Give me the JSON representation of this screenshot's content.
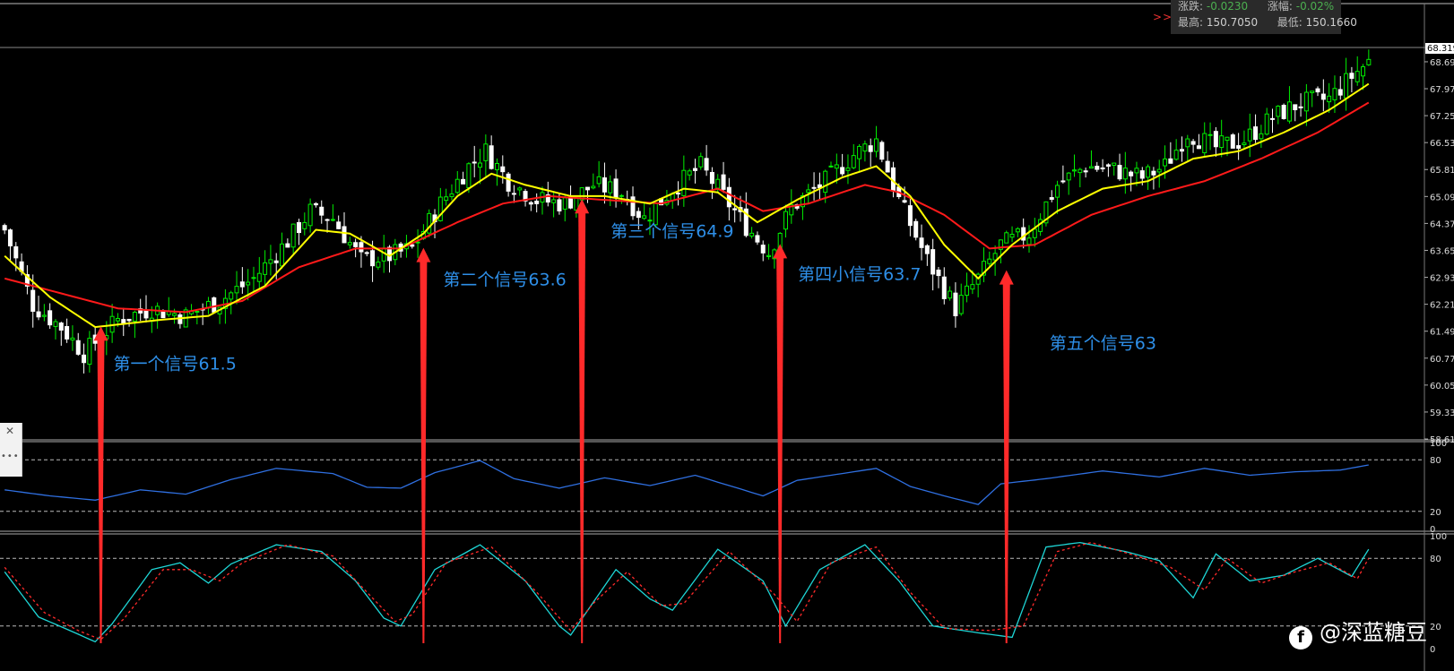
{
  "info_panel": {
    "change_label": "涨跌:",
    "change_value": "-0.0230",
    "pct_label": "涨幅:",
    "pct_value": "-0.02%",
    "high_label": "最高:",
    "high_value": "150.7050",
    "low_label": "最低:",
    "low_value": "150.1660",
    "arrows": ">>"
  },
  "watermark": {
    "text": "@深蓝糖豆"
  },
  "colors": {
    "background": "#000000",
    "bull_candle": "#00ee00",
    "bear_candle": "#ffffff",
    "fast_ma": "#ffff00",
    "slow_ma": "#ff1a1a",
    "rsi_line": "#2f6fe0",
    "stoch_k": "#1ed6d6",
    "stoch_d": "#ff2a2a",
    "annotation_text": "#2e8fe8",
    "signal_arrow": "#ff2a2a"
  },
  "chart_data": [
    {
      "type": "candlestick",
      "name": "price",
      "ylim": [
        58.61,
        69.0
      ],
      "current_price": "68.319",
      "y_ticks": [
        "68.690",
        "67.970",
        "67.250",
        "66.530",
        "65.810",
        "65.090",
        "64.370",
        "63.650",
        "62.930",
        "62.210",
        "61.490",
        "60.770",
        "60.050",
        "59.330",
        "58.610"
      ],
      "close_path": [
        {
          "i": 0,
          "v": 64.2
        },
        {
          "i": 5,
          "v": 62.2
        },
        {
          "i": 10,
          "v": 61.6
        },
        {
          "i": 14,
          "v": 60.9
        },
        {
          "i": 20,
          "v": 61.8
        },
        {
          "i": 26,
          "v": 62.1
        },
        {
          "i": 32,
          "v": 61.9
        },
        {
          "i": 38,
          "v": 62.3
        },
        {
          "i": 44,
          "v": 62.9
        },
        {
          "i": 50,
          "v": 63.9
        },
        {
          "i": 54,
          "v": 64.7
        },
        {
          "i": 58,
          "v": 64.5
        },
        {
          "i": 63,
          "v": 63.4
        },
        {
          "i": 68,
          "v": 63.5
        },
        {
          "i": 72,
          "v": 63.7
        },
        {
          "i": 77,
          "v": 64.9
        },
        {
          "i": 82,
          "v": 65.9
        },
        {
          "i": 85,
          "v": 66.3
        },
        {
          "i": 89,
          "v": 65.5
        },
        {
          "i": 94,
          "v": 65.0
        },
        {
          "i": 99,
          "v": 64.9
        },
        {
          "i": 104,
          "v": 65.4
        },
        {
          "i": 109,
          "v": 65.2
        },
        {
          "i": 113,
          "v": 64.5
        },
        {
          "i": 118,
          "v": 65.3
        },
        {
          "i": 123,
          "v": 65.9
        },
        {
          "i": 127,
          "v": 65.1
        },
        {
          "i": 131,
          "v": 64.3
        },
        {
          "i": 135,
          "v": 63.6
        },
        {
          "i": 139,
          "v": 64.8
        },
        {
          "i": 145,
          "v": 65.5
        },
        {
          "i": 150,
          "v": 66.2
        },
        {
          "i": 154,
          "v": 66.6
        },
        {
          "i": 158,
          "v": 65.0
        },
        {
          "i": 163,
          "v": 63.4
        },
        {
          "i": 168,
          "v": 62.1
        },
        {
          "i": 172,
          "v": 62.9
        },
        {
          "i": 176,
          "v": 63.8
        },
        {
          "i": 181,
          "v": 64.1
        },
        {
          "i": 186,
          "v": 65.4
        },
        {
          "i": 191,
          "v": 65.9
        },
        {
          "i": 196,
          "v": 65.8
        },
        {
          "i": 201,
          "v": 65.6
        },
        {
          "i": 205,
          "v": 65.9
        },
        {
          "i": 209,
          "v": 66.8
        },
        {
          "i": 214,
          "v": 66.4
        },
        {
          "i": 219,
          "v": 66.6
        },
        {
          "i": 224,
          "v": 67.2
        },
        {
          "i": 229,
          "v": 67.6
        },
        {
          "i": 234,
          "v": 67.7
        },
        {
          "i": 238,
          "v": 68.3
        },
        {
          "i": 241,
          "v": 68.7
        }
      ],
      "bar_count": 242,
      "fast_ma_path": [
        {
          "i": 0,
          "v": 63.5
        },
        {
          "i": 8,
          "v": 62.4
        },
        {
          "i": 16,
          "v": 61.6
        },
        {
          "i": 28,
          "v": 61.8
        },
        {
          "i": 36,
          "v": 61.9
        },
        {
          "i": 46,
          "v": 62.7
        },
        {
          "i": 55,
          "v": 64.2
        },
        {
          "i": 61,
          "v": 64.1
        },
        {
          "i": 68,
          "v": 63.5
        },
        {
          "i": 74,
          "v": 64.1
        },
        {
          "i": 80,
          "v": 65.1
        },
        {
          "i": 86,
          "v": 65.7
        },
        {
          "i": 92,
          "v": 65.4
        },
        {
          "i": 100,
          "v": 65.1
        },
        {
          "i": 106,
          "v": 65.1
        },
        {
          "i": 114,
          "v": 64.9
        },
        {
          "i": 120,
          "v": 65.3
        },
        {
          "i": 126,
          "v": 65.2
        },
        {
          "i": 133,
          "v": 64.4
        },
        {
          "i": 140,
          "v": 65.0
        },
        {
          "i": 148,
          "v": 65.6
        },
        {
          "i": 154,
          "v": 65.9
        },
        {
          "i": 160,
          "v": 65.1
        },
        {
          "i": 166,
          "v": 63.8
        },
        {
          "i": 172,
          "v": 62.9
        },
        {
          "i": 178,
          "v": 63.8
        },
        {
          "i": 186,
          "v": 64.7
        },
        {
          "i": 194,
          "v": 65.3
        },
        {
          "i": 202,
          "v": 65.5
        },
        {
          "i": 210,
          "v": 66.1
        },
        {
          "i": 218,
          "v": 66.3
        },
        {
          "i": 226,
          "v": 66.8
        },
        {
          "i": 234,
          "v": 67.4
        },
        {
          "i": 241,
          "v": 68.1
        }
      ],
      "slow_ma_path": [
        {
          "i": 0,
          "v": 62.9
        },
        {
          "i": 10,
          "v": 62.5
        },
        {
          "i": 20,
          "v": 62.1
        },
        {
          "i": 32,
          "v": 62.0
        },
        {
          "i": 42,
          "v": 62.3
        },
        {
          "i": 52,
          "v": 63.2
        },
        {
          "i": 62,
          "v": 63.7
        },
        {
          "i": 70,
          "v": 63.7
        },
        {
          "i": 80,
          "v": 64.4
        },
        {
          "i": 88,
          "v": 64.9
        },
        {
          "i": 96,
          "v": 65.1
        },
        {
          "i": 106,
          "v": 65.0
        },
        {
          "i": 116,
          "v": 64.9
        },
        {
          "i": 126,
          "v": 65.3
        },
        {
          "i": 134,
          "v": 64.7
        },
        {
          "i": 142,
          "v": 64.9
        },
        {
          "i": 152,
          "v": 65.4
        },
        {
          "i": 158,
          "v": 65.2
        },
        {
          "i": 166,
          "v": 64.6
        },
        {
          "i": 174,
          "v": 63.7
        },
        {
          "i": 182,
          "v": 63.8
        },
        {
          "i": 192,
          "v": 64.6
        },
        {
          "i": 202,
          "v": 65.1
        },
        {
          "i": 212,
          "v": 65.5
        },
        {
          "i": 222,
          "v": 66.1
        },
        {
          "i": 232,
          "v": 66.8
        },
        {
          "i": 241,
          "v": 67.6
        }
      ]
    },
    {
      "type": "line",
      "name": "oscillator-1",
      "ylim": [
        0,
        100
      ],
      "y_ticks": [
        "100",
        "80",
        "20",
        "0"
      ],
      "levels": [
        80,
        20
      ],
      "series": [
        {
          "path": [
            {
              "i": 0,
              "v": 45
            },
            {
              "i": 8,
              "v": 38
            },
            {
              "i": 16,
              "v": 33
            },
            {
              "i": 24,
              "v": 45
            },
            {
              "i": 32,
              "v": 40
            },
            {
              "i": 40,
              "v": 57
            },
            {
              "i": 48,
              "v": 70
            },
            {
              "i": 58,
              "v": 64
            },
            {
              "i": 64,
              "v": 48
            },
            {
              "i": 70,
              "v": 47
            },
            {
              "i": 76,
              "v": 65
            },
            {
              "i": 84,
              "v": 79
            },
            {
              "i": 90,
              "v": 58
            },
            {
              "i": 98,
              "v": 47
            },
            {
              "i": 106,
              "v": 59
            },
            {
              "i": 114,
              "v": 50
            },
            {
              "i": 122,
              "v": 62
            },
            {
              "i": 128,
              "v": 50
            },
            {
              "i": 134,
              "v": 38
            },
            {
              "i": 140,
              "v": 56
            },
            {
              "i": 148,
              "v": 64
            },
            {
              "i": 154,
              "v": 70
            },
            {
              "i": 160,
              "v": 49
            },
            {
              "i": 166,
              "v": 38
            },
            {
              "i": 172,
              "v": 28
            },
            {
              "i": 176,
              "v": 52
            },
            {
              "i": 184,
              "v": 58
            },
            {
              "i": 194,
              "v": 67
            },
            {
              "i": 204,
              "v": 60
            },
            {
              "i": 212,
              "v": 70
            },
            {
              "i": 220,
              "v": 62
            },
            {
              "i": 228,
              "v": 66
            },
            {
              "i": 236,
              "v": 68
            },
            {
              "i": 241,
              "v": 74
            }
          ]
        }
      ]
    },
    {
      "type": "line",
      "name": "oscillator-2",
      "ylim": [
        0,
        100
      ],
      "y_ticks": [
        "100",
        "80",
        "20",
        "0"
      ],
      "levels": [
        80,
        20
      ],
      "series": [
        {
          "path": [
            {
              "i": 0,
              "v": 68
            },
            {
              "i": 6,
              "v": 28
            },
            {
              "i": 12,
              "v": 15
            },
            {
              "i": 16,
              "v": 6
            },
            {
              "i": 19,
              "v": 22
            },
            {
              "i": 26,
              "v": 70
            },
            {
              "i": 31,
              "v": 76
            },
            {
              "i": 36,
              "v": 58
            },
            {
              "i": 40,
              "v": 75
            },
            {
              "i": 48,
              "v": 92
            },
            {
              "i": 56,
              "v": 86
            },
            {
              "i": 62,
              "v": 60
            },
            {
              "i": 67,
              "v": 27
            },
            {
              "i": 70,
              "v": 20
            },
            {
              "i": 76,
              "v": 70
            },
            {
              "i": 84,
              "v": 92
            },
            {
              "i": 92,
              "v": 60
            },
            {
              "i": 98,
              "v": 20
            },
            {
              "i": 100,
              "v": 12
            },
            {
              "i": 108,
              "v": 70
            },
            {
              "i": 114,
              "v": 44
            },
            {
              "i": 118,
              "v": 34
            },
            {
              "i": 126,
              "v": 88
            },
            {
              "i": 134,
              "v": 60
            },
            {
              "i": 138,
              "v": 20
            },
            {
              "i": 144,
              "v": 70
            },
            {
              "i": 152,
              "v": 92
            },
            {
              "i": 158,
              "v": 60
            },
            {
              "i": 164,
              "v": 20
            },
            {
              "i": 172,
              "v": 14
            },
            {
              "i": 178,
              "v": 10
            },
            {
              "i": 184,
              "v": 90
            },
            {
              "i": 190,
              "v": 94
            },
            {
              "i": 198,
              "v": 86
            },
            {
              "i": 204,
              "v": 78
            },
            {
              "i": 210,
              "v": 45
            },
            {
              "i": 214,
              "v": 84
            },
            {
              "i": 220,
              "v": 60
            },
            {
              "i": 226,
              "v": 65
            },
            {
              "i": 232,
              "v": 80
            },
            {
              "i": 238,
              "v": 64
            },
            {
              "i": 241,
              "v": 88
            }
          ]
        },
        {
          "path": [
            {
              "i": 0,
              "v": 72
            },
            {
              "i": 7,
              "v": 32
            },
            {
              "i": 13,
              "v": 16
            },
            {
              "i": 17,
              "v": 8
            },
            {
              "i": 21,
              "v": 26
            },
            {
              "i": 28,
              "v": 70
            },
            {
              "i": 33,
              "v": 70
            },
            {
              "i": 38,
              "v": 60
            },
            {
              "i": 42,
              "v": 76
            },
            {
              "i": 50,
              "v": 92
            },
            {
              "i": 58,
              "v": 82
            },
            {
              "i": 64,
              "v": 50
            },
            {
              "i": 69,
              "v": 24
            },
            {
              "i": 72,
              "v": 30
            },
            {
              "i": 78,
              "v": 76
            },
            {
              "i": 86,
              "v": 90
            },
            {
              "i": 94,
              "v": 50
            },
            {
              "i": 100,
              "v": 16
            },
            {
              "i": 104,
              "v": 40
            },
            {
              "i": 110,
              "v": 68
            },
            {
              "i": 116,
              "v": 38
            },
            {
              "i": 120,
              "v": 40
            },
            {
              "i": 128,
              "v": 86
            },
            {
              "i": 136,
              "v": 48
            },
            {
              "i": 140,
              "v": 24
            },
            {
              "i": 146,
              "v": 76
            },
            {
              "i": 154,
              "v": 90
            },
            {
              "i": 160,
              "v": 50
            },
            {
              "i": 166,
              "v": 18
            },
            {
              "i": 174,
              "v": 16
            },
            {
              "i": 180,
              "v": 20
            },
            {
              "i": 186,
              "v": 86
            },
            {
              "i": 192,
              "v": 94
            },
            {
              "i": 200,
              "v": 82
            },
            {
              "i": 206,
              "v": 72
            },
            {
              "i": 212,
              "v": 52
            },
            {
              "i": 216,
              "v": 80
            },
            {
              "i": 222,
              "v": 58
            },
            {
              "i": 228,
              "v": 68
            },
            {
              "i": 234,
              "v": 76
            },
            {
              "i": 239,
              "v": 62
            },
            {
              "i": 241,
              "v": 80
            }
          ]
        }
      ]
    }
  ],
  "signals": [
    {
      "bar": 17,
      "label": "第一个信号61.5",
      "price": 61.5
    },
    {
      "bar": 74,
      "label": "第二个信号63.6",
      "price": 63.6
    },
    {
      "bar": 102,
      "label": "第三个信号64.9",
      "price": 64.9
    },
    {
      "bar": 137,
      "label": "第四小信号63.7",
      "price": 63.7
    },
    {
      "bar": 177,
      "label": "第五个信号63",
      "price": 63.0
    }
  ]
}
